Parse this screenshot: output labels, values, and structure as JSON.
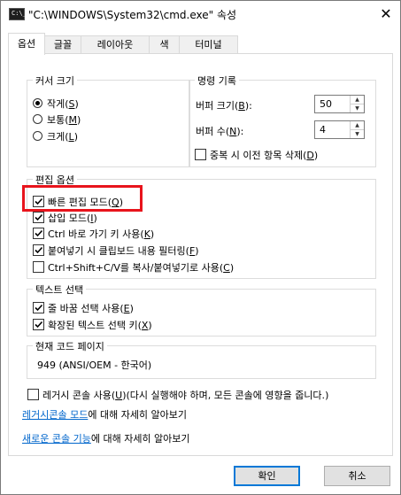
{
  "window": {
    "title": "\"C:\\WINDOWS\\System32\\cmd.exe\" 속성",
    "icon_text": "C:\\_",
    "close_glyph": "✕"
  },
  "tabs": [
    {
      "label": "옵션",
      "active": true
    },
    {
      "label": "글꼴",
      "active": false
    },
    {
      "label": "레이아웃",
      "active": false
    },
    {
      "label": "색",
      "active": false
    },
    {
      "label": "터미널",
      "active": false
    }
  ],
  "cursor_size": {
    "title": "커서 크기",
    "options": [
      {
        "label": "작게",
        "key": "S",
        "selected": true
      },
      {
        "label": "보통",
        "key": "M",
        "selected": false
      },
      {
        "label": "크게",
        "key": "L",
        "selected": false
      }
    ]
  },
  "command_history": {
    "title": "명령 기록",
    "buffer_size_label": "버퍼 크기",
    "buffer_size_key": "B",
    "buffer_size_value": "50",
    "buffer_count_label": "버퍼 수",
    "buffer_count_key": "N",
    "buffer_count_value": "4",
    "discard_label": "중복 시 이전 항목 삭제",
    "discard_key": "D",
    "discard_checked": false
  },
  "edit_options": {
    "title": "편집 옵션",
    "items": [
      {
        "label": "빠른 편집 모드",
        "key": "Q",
        "checked": true
      },
      {
        "label": "삽입 모드",
        "key": "I",
        "checked": true
      },
      {
        "label": "Ctrl 바로 가기 키 사용",
        "key": "K",
        "checked": true
      },
      {
        "label": "붙여넣기 시 클립보드 내용 필터링",
        "key": "F",
        "checked": true
      },
      {
        "label": "Ctrl+Shift+C/V를 복사/붙여넣기로 사용",
        "key": "C",
        "checked": false
      }
    ]
  },
  "text_selection": {
    "title": "텍스트 선택",
    "items": [
      {
        "label": "줄 바꿈 선택 사용",
        "key": "E",
        "checked": true
      },
      {
        "label": "확장된 텍스트 선택 키",
        "key": "X",
        "checked": true
      }
    ]
  },
  "code_page": {
    "title": "현재 코드 페이지",
    "value": "949   (ANSI/OEM - 한국어)"
  },
  "legacy": {
    "checkbox_label": "레거시 콘솔 사용",
    "checkbox_key": "U",
    "checkbox_note": "다시 실행해야 하며, 모든 콘솔에 영향을 줍니다.",
    "checked": false,
    "link_text": "레거시콘솔 모드",
    "link_suffix": "에 대해 자세히 알아보기"
  },
  "new_features": {
    "link_text": "새로운 콘솔 기능",
    "link_suffix": "에 대해 자세히 알아보기"
  },
  "buttons": {
    "ok": "확인",
    "cancel": "취소"
  },
  "colors": {
    "highlight": "#e8141c",
    "link": "#0066cc",
    "default_button_border": "#0078d7"
  }
}
